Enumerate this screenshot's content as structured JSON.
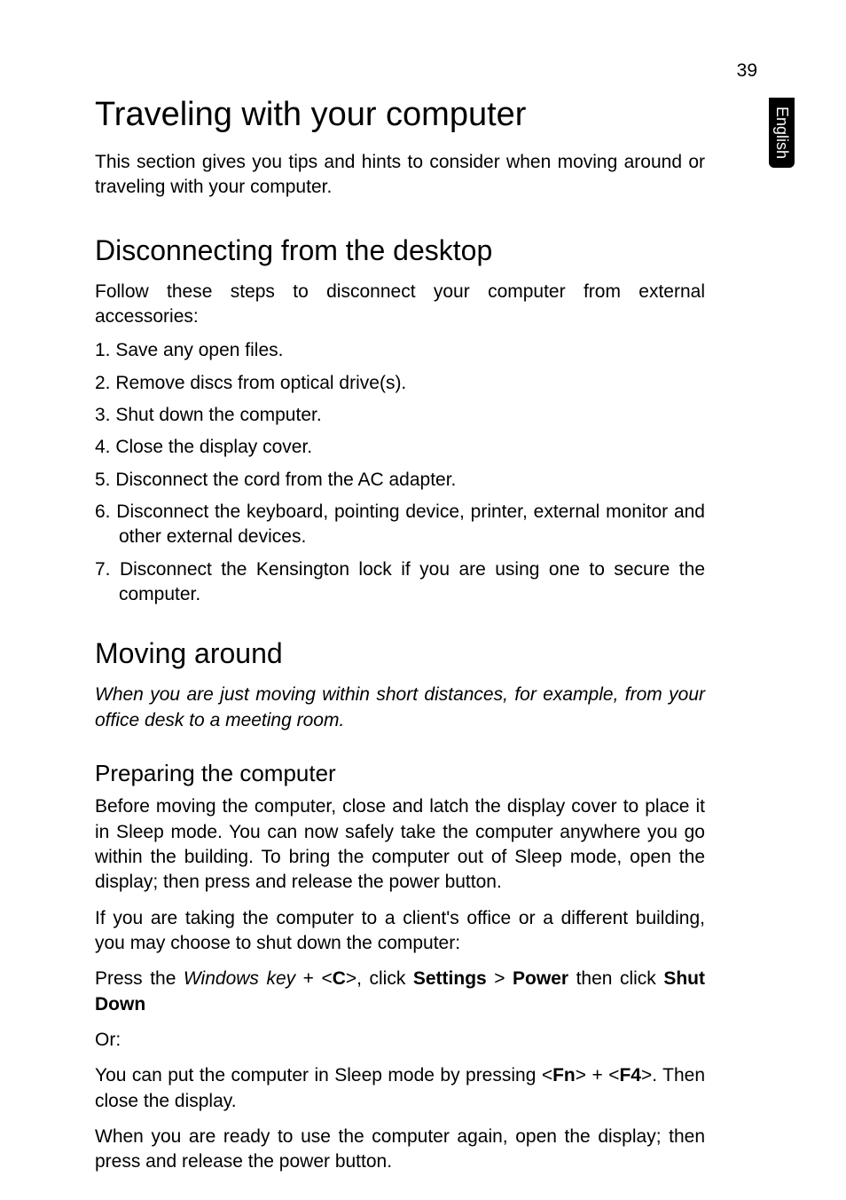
{
  "page": {
    "number": "39",
    "language_tab": "English"
  },
  "heading_main": "Traveling with your computer",
  "intro": "This section gives you tips and hints to consider when moving around or traveling with your computer.",
  "section1": {
    "heading": "Disconnecting from the desktop",
    "intro": "Follow these steps to disconnect your computer from external accessories:",
    "items": [
      "1. Save any open files.",
      "2. Remove discs from optical drive(s).",
      "3. Shut down the computer.",
      "4. Close the display cover.",
      "5. Disconnect the cord from the AC adapter.",
      "6. Disconnect the keyboard, pointing device, printer, external monitor and other external devices.",
      "7. Disconnect the Kensington lock if you are using one to secure the computer."
    ]
  },
  "section2": {
    "heading": "Moving around",
    "italic_intro": "When you are just moving within short distances, for example, from your office desk to a meeting room.",
    "sub": {
      "heading": "Preparing the computer",
      "p1": "Before moving the computer, close and latch the display cover to place it in Sleep mode. You can now safely take the computer anywhere you go within the building. To bring the computer out of Sleep mode, open the display; then press and release the power button.",
      "p2": "If you are taking the computer to a client's office or a different building, you may choose to shut down the computer:",
      "p3_prefix": "Press the ",
      "p3_winkey": "Windows key",
      "p3_mid1": " + <",
      "p3_c": "C",
      "p3_mid2": ">, click ",
      "p3_settings": "Settings",
      "p3_gt": " > ",
      "p3_power": "Power",
      "p3_mid3": " then click ",
      "p3_shutdown": "Shut Down",
      "p4": "Or:",
      "p5_prefix": "You can put the computer in Sleep mode by pressing <",
      "p5_fn": "Fn",
      "p5_mid": "> + <",
      "p5_f4": "F4",
      "p5_suffix": ">. Then close the display.",
      "p6": "When you are ready to use the computer again, open the display; then press and release the power button."
    }
  }
}
